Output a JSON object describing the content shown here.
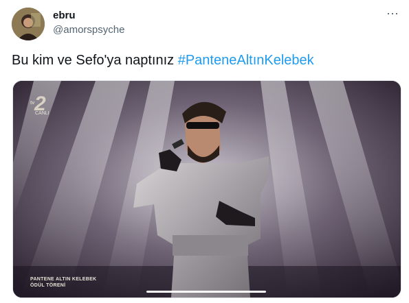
{
  "user": {
    "display_name": "ebru",
    "handle": "@amorspsyche"
  },
  "menu": {
    "more_icon": "⋯"
  },
  "tweet": {
    "text": "Bu kim ve Sefo'ya naptınız ",
    "hashtag": "#PanteneAltınKelebek"
  },
  "media": {
    "channel_number": "2",
    "channel_prefix": "tv",
    "channel_live": "CANLI",
    "caption_line1": "PANTENE ALTIN KELEBEK",
    "caption_line2": "ÖDÜL TÖRENİ"
  }
}
